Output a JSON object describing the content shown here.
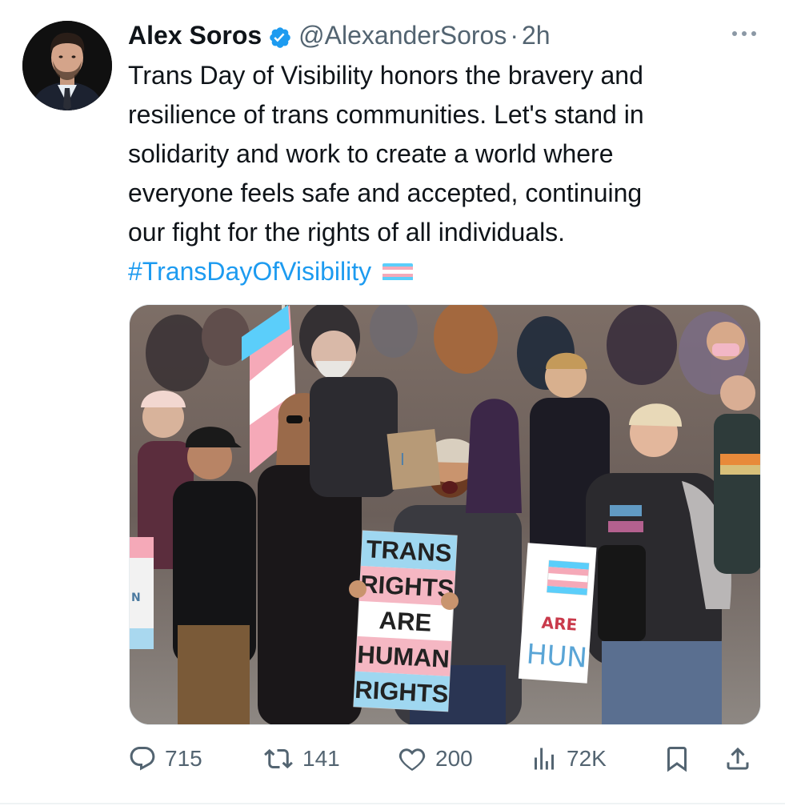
{
  "author": {
    "name": "Alex Soros",
    "handle": "@AlexanderSoros",
    "separator": "·",
    "time": "2h",
    "verified_icon": "verified-badge-icon"
  },
  "tweet": {
    "lines": [
      "Trans Day of Visibility honors the bravery and",
      "resilience of trans communities. Let's stand in",
      "solidarity and work to create a world where",
      "everyone feels safe and accepted, continuing",
      "our fight for the rights of all individuals."
    ],
    "hashtag": "#TransDayOfVisibility",
    "emoji": "transgender-flag-emoji"
  },
  "media": {
    "sign_lines": [
      "TRANS",
      "RIGHTS",
      "ARE",
      "HUMAN",
      "RIGHTS"
    ],
    "side_sign_text": "HUN",
    "side_sign_top": "ARE",
    "cardboard_sign": "I",
    "left_sign": "N"
  },
  "actions": {
    "replies": "715",
    "reposts": "141",
    "likes": "200",
    "views": "72K"
  },
  "colors": {
    "accent": "#1d9bf0",
    "muted": "#536471",
    "trans_blue": "#5bcefa",
    "trans_pink": "#f5a9b8",
    "white": "#ffffff"
  }
}
